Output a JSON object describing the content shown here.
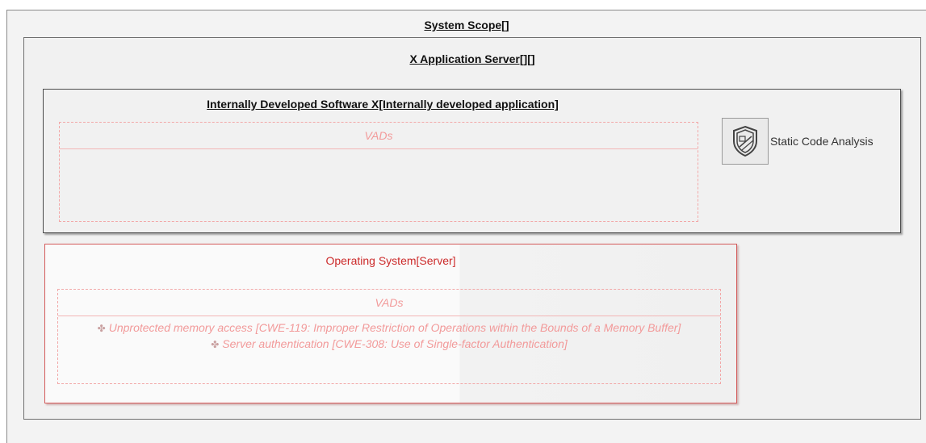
{
  "system_scope": {
    "title": "System Scope[]"
  },
  "app_server": {
    "title": "X Application Server[][]"
  },
  "internal_software": {
    "title": "Internally Developed Software X[Internally developed application]",
    "vads": {
      "header": "VADs",
      "items": []
    }
  },
  "static_code_analysis": {
    "label": "Static Code Analysis",
    "icon": "shield-icon"
  },
  "operating_system": {
    "title": "Operating System[Server]",
    "vads": {
      "header": "VADs",
      "bullet": "✤",
      "items": [
        "Unprotected memory access [CWE-119: Improper Restriction of Operations within the Bounds of a Memory Buffer]",
        "Server authentication [CWE-308: Use of Single-factor Authentication]"
      ]
    }
  },
  "colors": {
    "os_border": "#d45a5a",
    "os_title": "#cc2a2a",
    "vads_text": "#f29a9a",
    "vads_border": "#f2a8a8"
  }
}
